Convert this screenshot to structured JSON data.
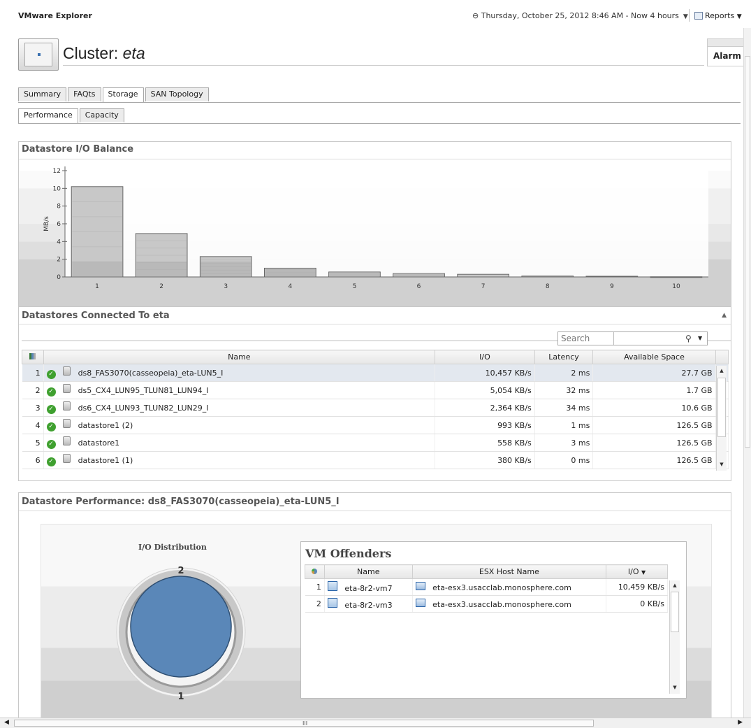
{
  "app": {
    "title": "VMware Explorer"
  },
  "topbar": {
    "timeframe": "Thursday, October 25, 2012 8:46 AM - Now 4 hours",
    "reports_label": "Reports"
  },
  "header": {
    "prefix": "Cluster: ",
    "cluster_name": "eta",
    "alarm_label": "Alarm"
  },
  "tabs": [
    {
      "label": "Summary",
      "active": false
    },
    {
      "label": "FAQts",
      "active": false
    },
    {
      "label": "Storage",
      "active": true
    },
    {
      "label": "SAN Topology",
      "active": false
    }
  ],
  "subtabs": [
    {
      "label": "Performance",
      "active": true
    },
    {
      "label": "Capacity",
      "active": false
    }
  ],
  "balance_panel": {
    "title": "Datastore I/O Balance"
  },
  "chart_data": {
    "type": "bar",
    "title": "Datastore I/O Balance",
    "xlabel": "",
    "ylabel": "MB/s",
    "categories": [
      "1",
      "2",
      "3",
      "4",
      "5",
      "6",
      "7",
      "8",
      "9",
      "10"
    ],
    "values": [
      10.2,
      4.9,
      2.3,
      0.99,
      0.56,
      0.38,
      0.3,
      0.1,
      0.08,
      0.02
    ],
    "ylim": [
      0,
      12
    ],
    "yticks": [
      "0",
      "2",
      "4",
      "6",
      "8",
      "10",
      "12"
    ],
    "grid": false,
    "legend": "none"
  },
  "datastores": {
    "title": "Datastores Connected To eta",
    "search_placeholder": "Search",
    "columns": {
      "name": "Name",
      "io": "I/O",
      "latency": "Latency",
      "space": "Available Space"
    },
    "rows": [
      {
        "n": "1",
        "name": "ds8_FAS3070(casseopeia)_eta-LUN5_I",
        "io": "10,457 KB/s",
        "latency": "2 ms",
        "space": "27.7 GB"
      },
      {
        "n": "2",
        "name": "ds5_CX4_LUN95_TLUN81_LUN94_I",
        "io": "5,054 KB/s",
        "latency": "32 ms",
        "space": "1.7 GB"
      },
      {
        "n": "3",
        "name": "ds6_CX4_LUN93_TLUN82_LUN29_I",
        "io": "2,364 KB/s",
        "latency": "34 ms",
        "space": "10.6 GB"
      },
      {
        "n": "4",
        "name": "datastore1 (2)",
        "io": "993 KB/s",
        "latency": "1 ms",
        "space": "126.5 GB"
      },
      {
        "n": "5",
        "name": "datastore1",
        "io": "558 KB/s",
        "latency": "3 ms",
        "space": "126.5 GB"
      },
      {
        "n": "6",
        "name": "datastore1 (1)",
        "io": "380 KB/s",
        "latency": "0 ms",
        "space": "126.5 GB"
      }
    ]
  },
  "performance": {
    "title": "Datastore Performance: ds8_FAS3070(casseopeia)_eta-LUN5_I",
    "io_distribution": {
      "title": "I/O Distribution",
      "label_top": "2",
      "label_bottom": "1",
      "colors": [
        "#5a87b8",
        "#d8d8d8"
      ]
    },
    "vm_offenders": {
      "title": "VM Offenders",
      "columns": {
        "name": "Name",
        "host": "ESX Host Name",
        "io": "I/O"
      },
      "rows": [
        {
          "n": "1",
          "name": "eta-8r2-vm7",
          "host": "eta-esx3.usacclab.monosphere.com",
          "io": "10,459 KB/s"
        },
        {
          "n": "2",
          "name": "eta-8r2-vm3",
          "host": "eta-esx3.usacclab.monosphere.com",
          "io": "0 KB/s"
        }
      ]
    }
  }
}
